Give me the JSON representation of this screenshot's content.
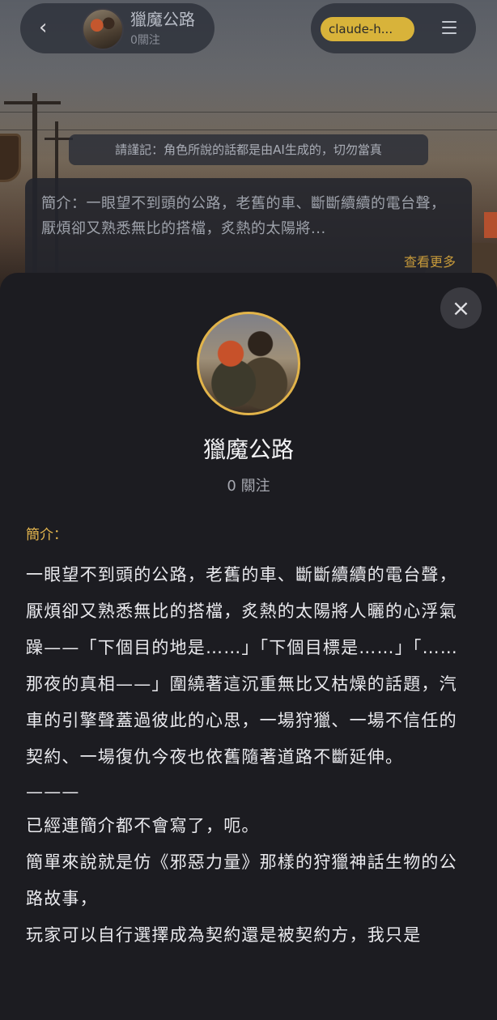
{
  "header": {
    "title": "獵魔公路",
    "followers": "0關注",
    "model": "claude-h..."
  },
  "disclaimer": "請謹記：角色所說的話都是由AI生成的，切勿當真",
  "intro_card": {
    "text": "簡介：一眼望不到頭的公路，老舊的車、斷斷續續的電台聲，厭煩卻又熟悉無比的搭檔，炙熱的太陽將...",
    "see_more": "查看更多"
  },
  "sheet": {
    "close_icon": "×",
    "title": "獵魔公路",
    "followers": "0 關注",
    "intro_label": "簡介：",
    "paragraphs": [
      "一眼望不到頭的公路，老舊的車、斷斷續續的電台聲，厭煩卻又熟悉無比的搭檔，炙熱的太陽將人曬的心浮氣躁——「下個目的地是……」「下個目標是……」「……那夜的真相——」圍繞著這沉重無比又枯燥的話題，汽車的引擎聲蓋過彼此的心思，一場狩獵、一場不信任的契約、一場復仇今夜也依舊隨著道路不斷延伸。",
      "———",
      "已經連簡介都不會寫了，呃。",
      "簡單來說就是仿《邪惡力量》那樣的狩獵神話生物的公路故事，",
      "玩家可以自行選擇成為契約還是被契約方，我只是"
    ]
  },
  "colors": {
    "accent_gold": "#e3b54e",
    "chip_gold": "#d8b33a",
    "sheet_bg": "#1c1c21"
  }
}
